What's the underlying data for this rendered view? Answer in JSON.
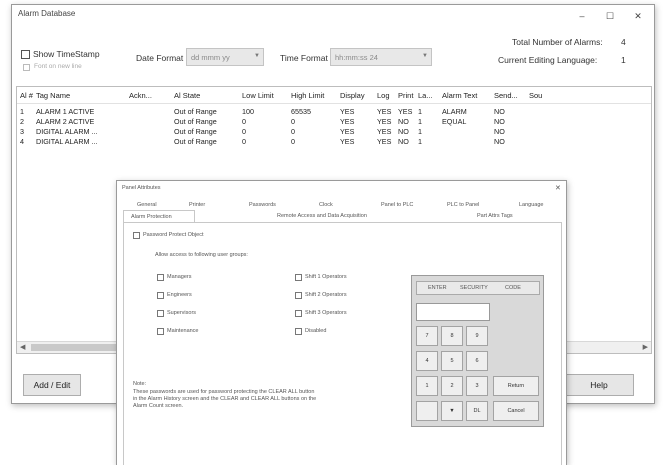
{
  "main": {
    "title": "Alarm Database",
    "controls": {
      "minimize": "–",
      "maximize": "☐",
      "close": "✕"
    },
    "show_timestamp": "Show TimeStamp",
    "font_sub_option": "Font on new line",
    "date_format_label": "Date Format",
    "date_format_value": "dd mmm yy",
    "time_format_label": "Time Format",
    "time_format_value": "hh:mm:ss 24",
    "total_alarms_label": "Total Number of Alarms:",
    "total_alarms_value": "4",
    "editing_language_label": "Current Editing Language:",
    "editing_language_value": "1",
    "columns": [
      "Al #",
      "Tag Name",
      "Ackn...",
      "Al State",
      "Low Limit",
      "High Limit",
      "Display",
      "Log",
      "Print",
      "La...",
      "Alarm Text",
      "Send...",
      "Sou"
    ],
    "rows": [
      [
        "1",
        "ALARM 1 ACTIVE",
        "",
        "Out of Range",
        "100",
        "65535",
        "YES",
        "YES",
        "YES",
        "1",
        "ALARM",
        "NO",
        ""
      ],
      [
        "2",
        "ALARM 2 ACTIVE",
        "",
        "Out of Range",
        "0",
        "0",
        "YES",
        "YES",
        "NO",
        "1",
        "EQUAL",
        "NO",
        ""
      ],
      [
        "3",
        "DIGITAL ALARM ...",
        "",
        "Out of Range",
        "0",
        "0",
        "YES",
        "YES",
        "NO",
        "1",
        "",
        "NO",
        ""
      ],
      [
        "4",
        "DIGITAL ALARM ...",
        "",
        "Out of Range",
        "0",
        "0",
        "YES",
        "YES",
        "NO",
        "1",
        "",
        "NO",
        ""
      ]
    ],
    "add_edit": "Add / Edit",
    "help": "Help"
  },
  "dialog": {
    "title": "Panel Attributes",
    "close": "✕",
    "tabs_top": [
      "General",
      "Printer",
      "Passwords",
      "Clock",
      "Panel to PLC",
      "PLC to Panel",
      "Language"
    ],
    "tabs_bottom": [
      "Alarm Protection",
      "Remote Access and Data Acquisition",
      "Part Attrs Tags"
    ],
    "password_protect": "Password Protect Object",
    "allow_access": "Allow access to following user groups:",
    "groups_left": [
      "Managers",
      "Engineers",
      "Supervisors",
      "Maintenance"
    ],
    "groups_right": [
      "Shift 1 Operators",
      "Shift 2 Operators",
      "Shift 3 Operators",
      "Disabled"
    ],
    "note_title": "Note:",
    "note_lines": [
      "These passwords are used for password protecting the CLEAR ALL button",
      "in the Alarm History screen and the CLEAR and CLEAR ALL buttons on the",
      "Alarm Count screen."
    ]
  },
  "keypad": {
    "header": [
      "ENTER",
      "SECURITY",
      "CODE"
    ],
    "keys": [
      [
        "7",
        "8",
        "9"
      ],
      [
        "4",
        "5",
        "6"
      ],
      [
        "1",
        "2",
        "3"
      ]
    ],
    "bottom": [
      "",
      "▼",
      "DL"
    ],
    "return": "Return",
    "cancel": "Cancel"
  }
}
